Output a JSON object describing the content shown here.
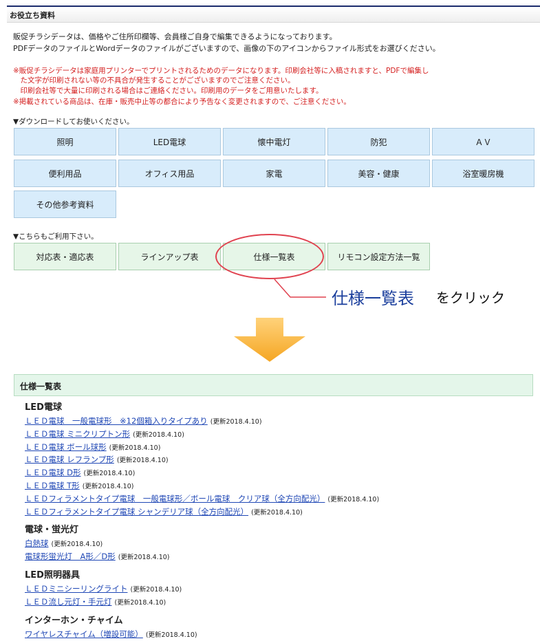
{
  "header": {
    "title": "お役立ち資料"
  },
  "intro": [
    "販促チラシデータは、価格やご住所印欄等、会員様ご自身で編集できるようになっております。",
    "PDFデータのファイルとWordデータのファイルがございますので、画像の下のアイコンからファイル形式をお選びください。"
  ],
  "notes": [
    "※販促チラシデータは家庭用プリンターでプリントされるためのデータになります。印刷会社等に入稿されますと、PDFで編集し",
    "　た文字が印刷されない等の不具合が発生することがございますのでご注意ください。",
    "　印刷会社等で大量に印刷される場合はご連絡ください。印刷用のデータをご用意いたします。",
    "※掲載されている商品は、在庫・販売中止等の都合により予告なく変更されますので、ご注意ください。"
  ],
  "download": {
    "heading": "▼ダウンロードしてお使いください。",
    "buttons": [
      "照明",
      "LED電球",
      "懐中電灯",
      "防犯",
      "ＡＶ",
      "便利用品",
      "オフィス用品",
      "家電",
      "美容・健康",
      "浴室暖房機",
      "その他参考資料"
    ]
  },
  "also": {
    "heading": "▼こちらもご利用下さい。",
    "buttons": [
      "対応表・適応表",
      "ラインアップ表",
      "仕様一覧表",
      "リモコン設定方法一覧"
    ]
  },
  "callout": {
    "label": "仕様一覧表",
    "text": "をクリック"
  },
  "colors": {
    "accent_red": "#e0424f",
    "link": "#1f47b5",
    "button_blue": "#d8ecfb",
    "button_green": "#e6f6e8",
    "arrow": "#f5a623"
  },
  "spec_list": {
    "title": "仕様一覧表",
    "categories": [
      {
        "name": "LED電球",
        "items": [
          {
            "label": "ＬＥＤ電球　一般電球形　※12個箱入りタイプあり",
            "updated": "(更新2018.4.10)"
          },
          {
            "label": "ＬＥＤ電球 ミニクリプトン形",
            "updated": "(更新2018.4.10)"
          },
          {
            "label": "ＬＥＤ電球 ボール球形",
            "updated": "(更新2018.4.10)"
          },
          {
            "label": "ＬＥＤ電球 レフランプ形",
            "updated": "(更新2018.4.10)"
          },
          {
            "label": "ＬＥＤ電球 D形",
            "updated": "(更新2018.4.10)"
          },
          {
            "label": "ＬＥＤ電球 T形",
            "updated": "(更新2018.4.10)"
          },
          {
            "label": "ＬＥＤフィラメントタイプ電球　一般電球形／ボール電球　クリア球（全方向配光）",
            "updated": "(更新2018.4.10)"
          },
          {
            "label": "ＬＥＤフィラメントタイプ電球 シャンデリア球（全方向配光）",
            "updated": "(更新2018.4.10)"
          }
        ]
      },
      {
        "name": "電球・蛍光灯",
        "items": [
          {
            "label": "白熱球",
            "updated": "(更新2018.4.10)"
          },
          {
            "label": "電球形蛍光灯　A形／D形",
            "updated": "(更新2018.4.10)"
          }
        ]
      },
      {
        "name": "LED照明器具",
        "items": [
          {
            "label": "ＬＥＤミニシーリングライト",
            "updated": "(更新2018.4.10)"
          },
          {
            "label": "ＬＥＤ流し元灯・手元灯",
            "updated": "(更新2018.4.10)"
          }
        ]
      },
      {
        "name": "インターホン・チャイム",
        "items": [
          {
            "label": "ワイヤレスチャイム（増設可能）",
            "updated": "(更新2018.4.10)"
          }
        ]
      }
    ]
  }
}
